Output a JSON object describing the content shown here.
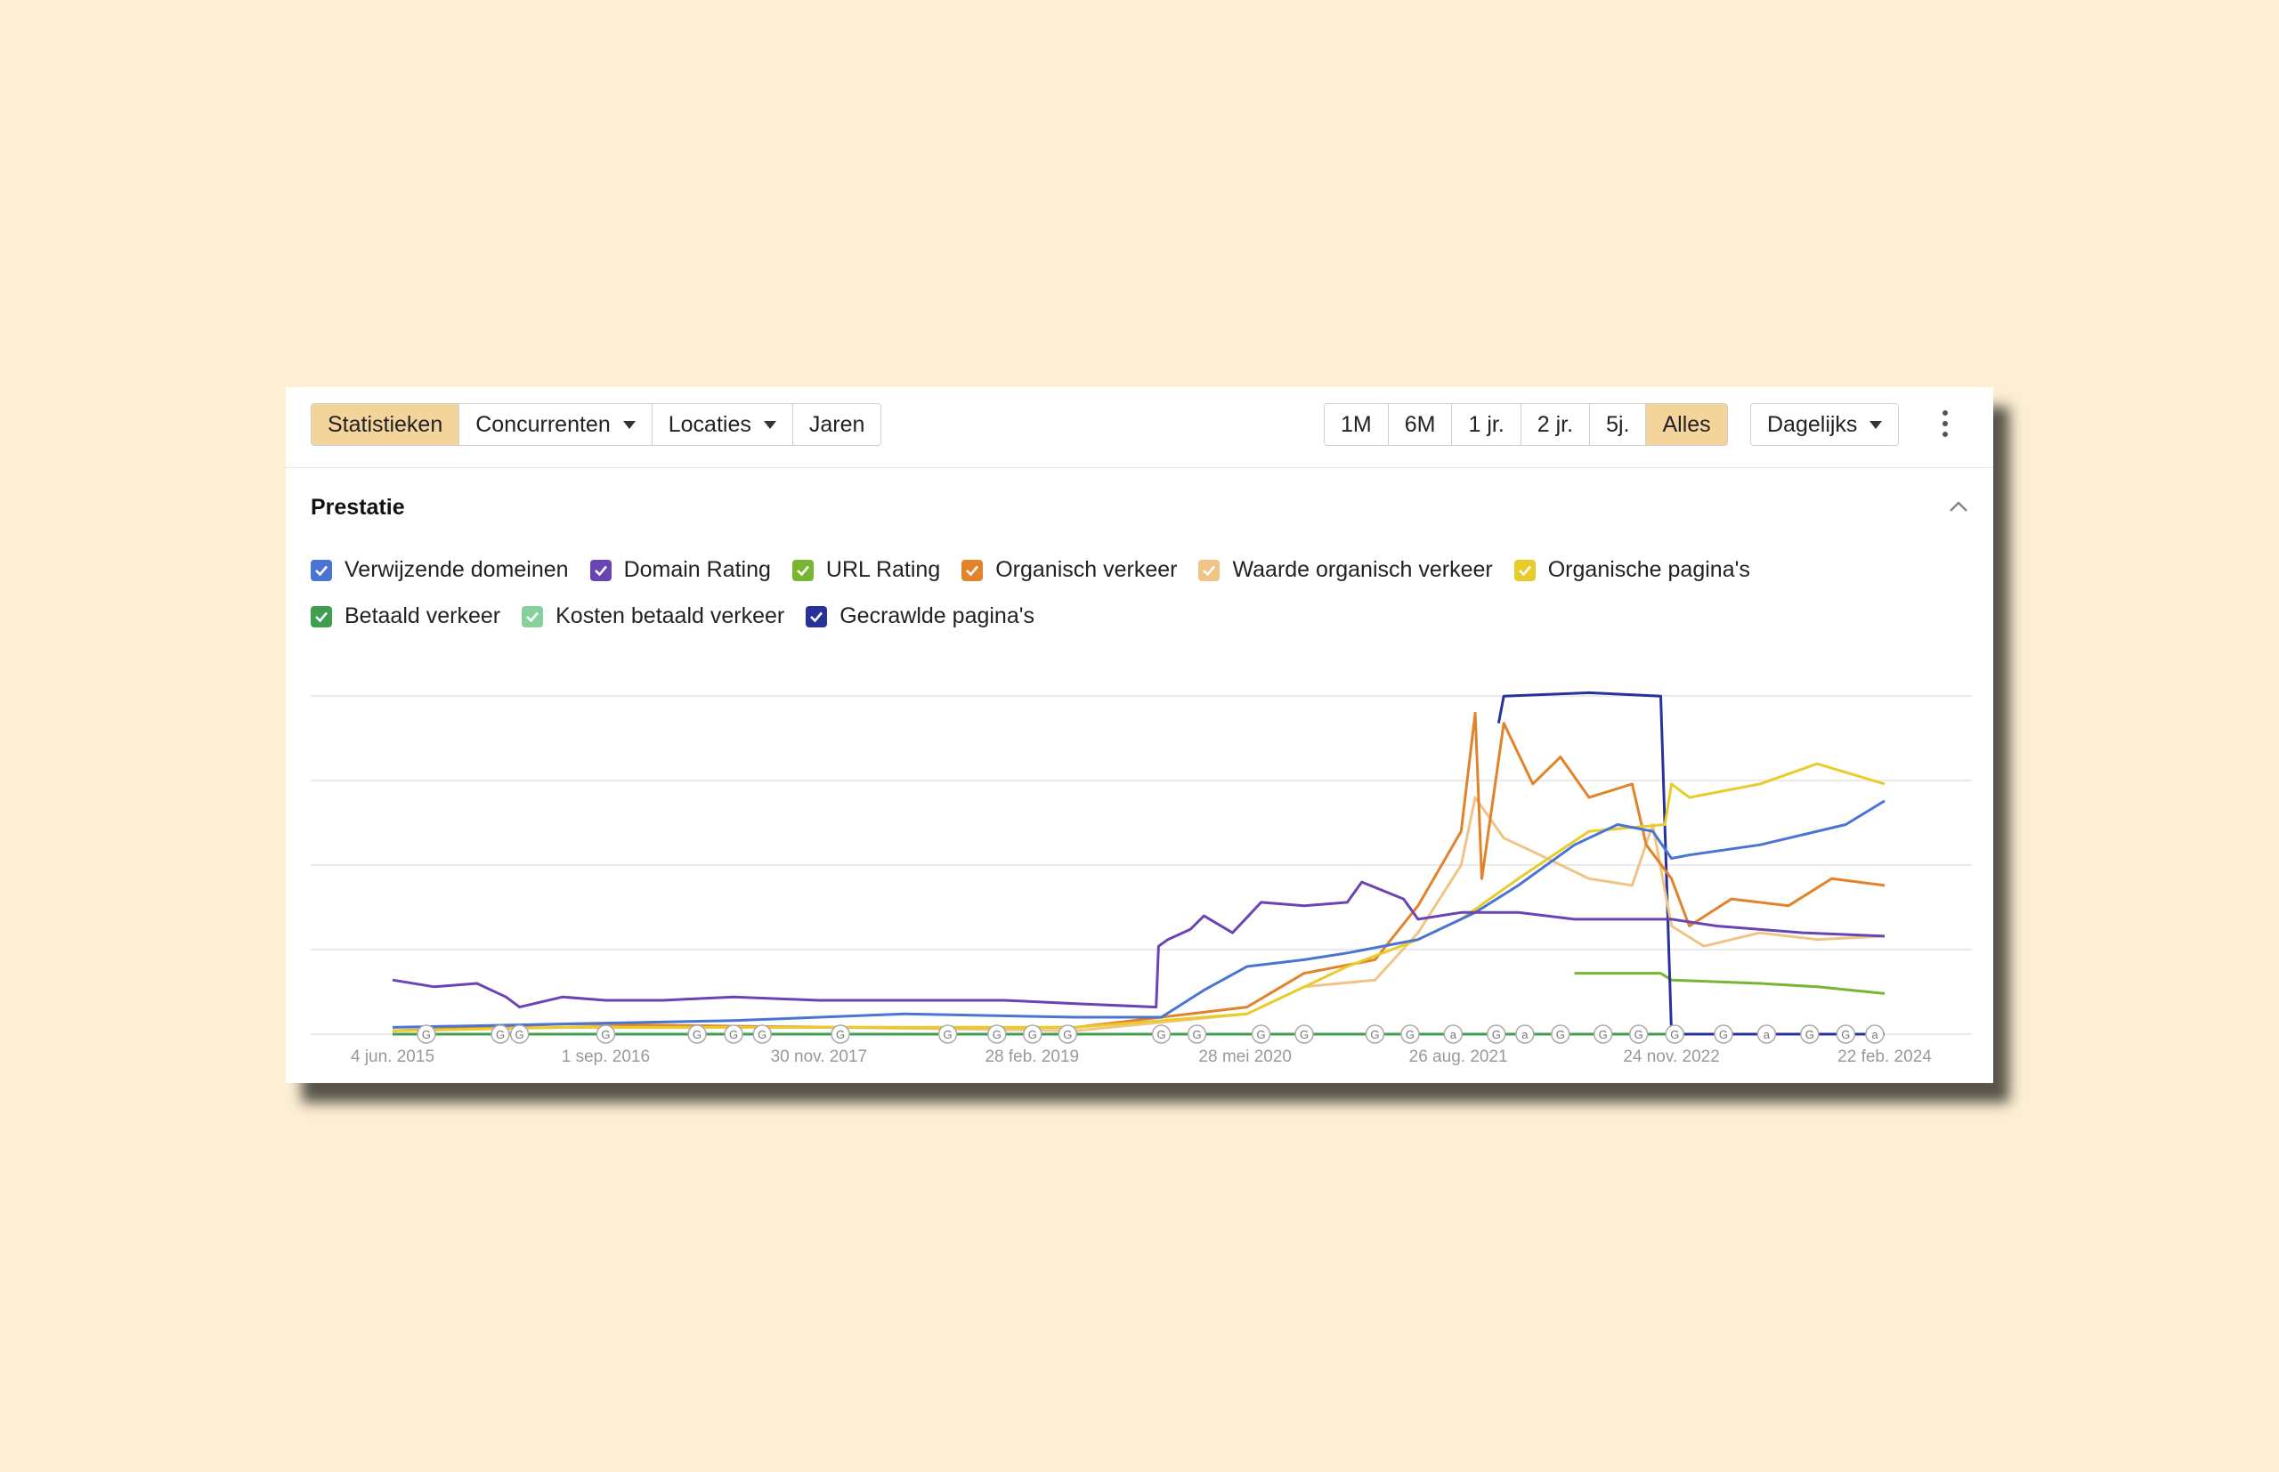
{
  "toolbar": {
    "tabs": [
      {
        "label": "Statistieken",
        "active": true,
        "dropdown": false
      },
      {
        "label": "Concurrenten",
        "active": false,
        "dropdown": true
      },
      {
        "label": "Locaties",
        "active": false,
        "dropdown": true
      },
      {
        "label": "Jaren",
        "active": false,
        "dropdown": false
      }
    ],
    "ranges": [
      {
        "label": "1M",
        "active": false
      },
      {
        "label": "6M",
        "active": false
      },
      {
        "label": "1 jr.",
        "active": false
      },
      {
        "label": "2 jr.",
        "active": false
      },
      {
        "label": "5j.",
        "active": false
      },
      {
        "label": "Alles",
        "active": true
      }
    ],
    "interval": "Dagelijks",
    "more_icon": "kebab-menu-icon"
  },
  "section": {
    "title": "Prestatie",
    "collapse_icon": "chevron-up-icon"
  },
  "legend": [
    {
      "label": "Verwijzende domeinen",
      "color": "#4a74d4",
      "checked": true
    },
    {
      "label": "Domain Rating",
      "color": "#6a44b4",
      "checked": true
    },
    {
      "label": "URL Rating",
      "color": "#78b531",
      "checked": true
    },
    {
      "label": "Organisch verkeer",
      "color": "#e2832b",
      "checked": true
    },
    {
      "label": "Waarde organisch verkeer",
      "color": "#f0c486",
      "checked": true
    },
    {
      "label": "Organische pagina's",
      "color": "#e8cc2a",
      "checked": true
    },
    {
      "label": "Betaald verkeer",
      "color": "#3f9e4f",
      "checked": true
    },
    {
      "label": "Kosten betaald verkeer",
      "color": "#86d09a",
      "checked": true
    },
    {
      "label": "Gecrawlde pagina's",
      "color": "#27339a",
      "checked": true
    }
  ],
  "chart_data": {
    "type": "line",
    "x_ticks": [
      "4 jun. 2015",
      "1 sep. 2016",
      "30 nov. 2017",
      "28 feb. 2019",
      "28 mei 2020",
      "26 aug. 2021",
      "24 nov. 2022",
      "22 feb. 2024"
    ],
    "xlim": [
      "2015-06-04",
      "2024-02-22"
    ],
    "ylim": [
      0,
      100
    ],
    "grid": true,
    "y_tick_labels_shown": false,
    "series": [
      {
        "name": "Domain Rating",
        "color": "#6a44b4",
        "points": [
          [
            "2015-06-04",
            16
          ],
          [
            "2015-09-01",
            14
          ],
          [
            "2015-12-01",
            15
          ],
          [
            "2016-02-01",
            11
          ],
          [
            "2016-03-01",
            8
          ],
          [
            "2016-06-01",
            11
          ],
          [
            "2016-09-01",
            10
          ],
          [
            "2017-01-01",
            10
          ],
          [
            "2017-06-01",
            11
          ],
          [
            "2017-11-30",
            10
          ],
          [
            "2018-06-01",
            10
          ],
          [
            "2019-01-01",
            10
          ],
          [
            "2019-06-01",
            9
          ],
          [
            "2019-11-20",
            8
          ],
          [
            "2019-11-25",
            26
          ],
          [
            "2019-12-15",
            28
          ],
          [
            "2020-02-01",
            31
          ],
          [
            "2020-03-01",
            35
          ],
          [
            "2020-05-01",
            30
          ],
          [
            "2020-07-01",
            39
          ],
          [
            "2020-10-01",
            38
          ],
          [
            "2021-01-01",
            39
          ],
          [
            "2021-02-01",
            45
          ],
          [
            "2021-05-01",
            40
          ],
          [
            "2021-06-01",
            34
          ],
          [
            "2021-09-01",
            36
          ],
          [
            "2022-01-01",
            36
          ],
          [
            "2022-05-01",
            34
          ],
          [
            "2022-11-24",
            34
          ],
          [
            "2023-03-01",
            32
          ],
          [
            "2023-09-01",
            30
          ],
          [
            "2024-02-22",
            29
          ]
        ]
      },
      {
        "name": "Verwijzende domeinen",
        "color": "#4a74d4",
        "points": [
          [
            "2015-06-04",
            2
          ],
          [
            "2016-06-01",
            3
          ],
          [
            "2017-06-01",
            4
          ],
          [
            "2018-06-01",
            6
          ],
          [
            "2019-06-01",
            5
          ],
          [
            "2019-12-01",
            5
          ],
          [
            "2020-03-01",
            13
          ],
          [
            "2020-06-01",
            20
          ],
          [
            "2020-10-01",
            22
          ],
          [
            "2021-01-01",
            24
          ],
          [
            "2021-06-01",
            28
          ],
          [
            "2021-10-01",
            36
          ],
          [
            "2022-01-01",
            44
          ],
          [
            "2022-05-01",
            56
          ],
          [
            "2022-08-01",
            62
          ],
          [
            "2022-10-15",
            60
          ],
          [
            "2022-11-24",
            52
          ],
          [
            "2023-01-01",
            53
          ],
          [
            "2023-06-01",
            56
          ],
          [
            "2023-12-01",
            62
          ],
          [
            "2024-02-22",
            69
          ]
        ]
      },
      {
        "name": "Organische pagina's",
        "color": "#e8cc2a",
        "points": [
          [
            "2015-06-04",
            1
          ],
          [
            "2016-06-01",
            2
          ],
          [
            "2018-01-01",
            2
          ],
          [
            "2019-06-01",
            2
          ],
          [
            "2020-06-01",
            6
          ],
          [
            "2020-09-01",
            12
          ],
          [
            "2021-01-01",
            20
          ],
          [
            "2021-06-01",
            28
          ],
          [
            "2021-09-01",
            34
          ],
          [
            "2022-01-01",
            46
          ],
          [
            "2022-06-01",
            60
          ],
          [
            "2022-11-10",
            62
          ],
          [
            "2022-11-24",
            74
          ],
          [
            "2023-01-01",
            70
          ],
          [
            "2023-06-01",
            74
          ],
          [
            "2023-10-01",
            80
          ],
          [
            "2024-02-22",
            74
          ]
        ]
      },
      {
        "name": "Organisch verkeer",
        "color": "#e2832b",
        "points": [
          [
            "2015-06-04",
            1
          ],
          [
            "2016-06-01",
            3
          ],
          [
            "2018-01-01",
            2
          ],
          [
            "2019-06-01",
            2
          ],
          [
            "2020-06-01",
            8
          ],
          [
            "2020-10-01",
            18
          ],
          [
            "2021-03-01",
            22
          ],
          [
            "2021-06-01",
            38
          ],
          [
            "2021-09-01",
            60
          ],
          [
            "2021-10-01",
            95
          ],
          [
            "2021-10-15",
            46
          ],
          [
            "2021-12-01",
            92
          ],
          [
            "2022-02-01",
            74
          ],
          [
            "2022-04-01",
            82
          ],
          [
            "2022-06-01",
            70
          ],
          [
            "2022-09-01",
            74
          ],
          [
            "2022-10-01",
            56
          ],
          [
            "2022-11-24",
            46
          ],
          [
            "2023-01-01",
            32
          ],
          [
            "2023-04-01",
            40
          ],
          [
            "2023-08-01",
            38
          ],
          [
            "2023-11-01",
            46
          ],
          [
            "2024-02-22",
            44
          ]
        ]
      },
      {
        "name": "Waarde organisch verkeer",
        "color": "#f0c486",
        "points": [
          [
            "2015-06-04",
            1
          ],
          [
            "2016-06-01",
            2
          ],
          [
            "2018-01-01",
            2
          ],
          [
            "2019-06-01",
            1
          ],
          [
            "2020-06-01",
            6
          ],
          [
            "2020-10-01",
            14
          ],
          [
            "2021-03-01",
            16
          ],
          [
            "2021-06-01",
            30
          ],
          [
            "2021-09-01",
            50
          ],
          [
            "2021-10-01",
            70
          ],
          [
            "2021-12-01",
            58
          ],
          [
            "2022-02-01",
            54
          ],
          [
            "2022-06-01",
            46
          ],
          [
            "2022-09-01",
            44
          ],
          [
            "2022-10-15",
            62
          ],
          [
            "2022-11-24",
            32
          ],
          [
            "2023-02-01",
            26
          ],
          [
            "2023-06-01",
            30
          ],
          [
            "2023-10-01",
            28
          ],
          [
            "2024-02-22",
            29
          ]
        ]
      },
      {
        "name": "Gecrawlde pagina's",
        "color": "#27339a",
        "points": [
          [
            "2021-11-20",
            92
          ],
          [
            "2021-12-01",
            100
          ],
          [
            "2022-06-01",
            101
          ],
          [
            "2022-11-01",
            100
          ],
          [
            "2022-11-24",
            0
          ],
          [
            "2023-06-01",
            0
          ],
          [
            "2024-02-22",
            0
          ]
        ]
      },
      {
        "name": "URL Rating",
        "color": "#78b531",
        "points": [
          [
            "2022-05-01",
            18
          ],
          [
            "2022-11-01",
            18
          ],
          [
            "2022-11-24",
            16
          ],
          [
            "2023-06-01",
            15
          ],
          [
            "2023-10-01",
            14
          ],
          [
            "2024-02-22",
            12
          ]
        ]
      },
      {
        "name": "Betaald verkeer",
        "color": "#3f9e4f",
        "points": [
          [
            "2015-06-04",
            0
          ],
          [
            "2024-02-22",
            0
          ]
        ]
      },
      {
        "name": "Kosten betaald verkeer",
        "color": "#86d09a",
        "points": [
          [
            "2015-06-04",
            0
          ],
          [
            "2024-02-22",
            0
          ]
        ]
      }
    ],
    "annotation_marker_labels": [
      "G",
      "a"
    ],
    "annotations": [
      {
        "date": "2015-08-15",
        "label": "G"
      },
      {
        "date": "2016-01-20",
        "label": "G"
      },
      {
        "date": "2016-03-01",
        "label": "G"
      },
      {
        "date": "2016-09-01",
        "label": "G"
      },
      {
        "date": "2017-03-15",
        "label": "G"
      },
      {
        "date": "2017-06-01",
        "label": "G"
      },
      {
        "date": "2017-08-01",
        "label": "G"
      },
      {
        "date": "2018-01-15",
        "label": "G"
      },
      {
        "date": "2018-09-01",
        "label": "G"
      },
      {
        "date": "2018-12-15",
        "label": "G"
      },
      {
        "date": "2019-03-01",
        "label": "G"
      },
      {
        "date": "2019-05-15",
        "label": "G"
      },
      {
        "date": "2019-12-01",
        "label": "G"
      },
      {
        "date": "2020-02-15",
        "label": "G"
      },
      {
        "date": "2020-07-01",
        "label": "G"
      },
      {
        "date": "2020-10-01",
        "label": "G"
      },
      {
        "date": "2021-03-01",
        "label": "G"
      },
      {
        "date": "2021-05-15",
        "label": "G"
      },
      {
        "date": "2021-08-15",
        "label": "a"
      },
      {
        "date": "2021-11-15",
        "label": "G"
      },
      {
        "date": "2022-01-15",
        "label": "a"
      },
      {
        "date": "2022-04-01",
        "label": "G"
      },
      {
        "date": "2022-07-01",
        "label": "G"
      },
      {
        "date": "2022-09-15",
        "label": "G"
      },
      {
        "date": "2022-12-01",
        "label": "G"
      },
      {
        "date": "2023-03-15",
        "label": "G"
      },
      {
        "date": "2023-06-15",
        "label": "a"
      },
      {
        "date": "2023-09-15",
        "label": "G"
      },
      {
        "date": "2023-12-01",
        "label": "G"
      },
      {
        "date": "2024-02-01",
        "label": "a"
      }
    ]
  }
}
